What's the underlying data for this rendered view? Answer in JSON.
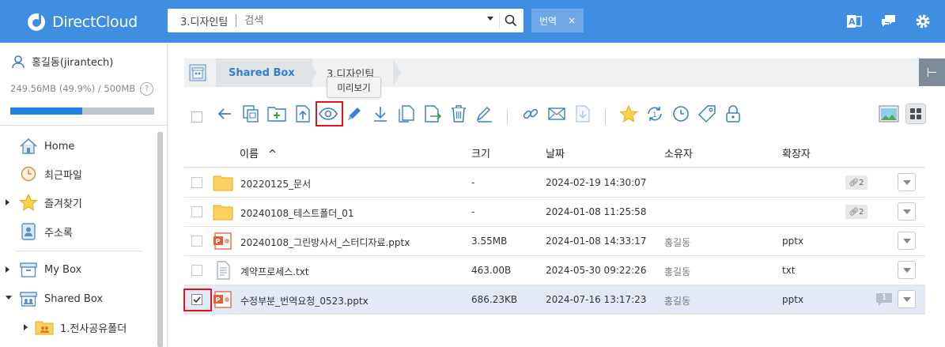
{
  "app": {
    "logo_text": "DirectCloud"
  },
  "search": {
    "folder": "3.디자인팀",
    "placeholder": "검색"
  },
  "tag_chip": {
    "label": "번역",
    "close": "×"
  },
  "header_icons": [
    "translate-icon",
    "chat-icon",
    "settings-gear-icon"
  ],
  "user": {
    "name": "홍길동(jirantech)"
  },
  "quota": {
    "text": "249.56MB (49.9%) / 500MB",
    "help": "?",
    "percent": 49.9
  },
  "sidebar": {
    "items": [
      {
        "label": "Home",
        "icon": "home-icon"
      },
      {
        "label": "최근파일",
        "icon": "recent-clock-icon"
      },
      {
        "label": "즐겨찾기",
        "icon": "star-icon"
      },
      {
        "label": "주소록",
        "icon": "address-book-icon"
      },
      {
        "label": "My Box",
        "icon": "my-box-icon"
      },
      {
        "label": "Shared Box",
        "icon": "shared-box-icon"
      },
      {
        "label": "1.전사공유폴더",
        "icon": "shared-folder-icon"
      }
    ]
  },
  "breadcrumb": {
    "items": [
      "Shared Box",
      "3.디자인팀"
    ]
  },
  "tooltip": {
    "text": "미리보기"
  },
  "toggle": {
    "label": "⊢"
  },
  "table": {
    "columns": [
      "이름",
      "크기",
      "날짜",
      "소유자",
      "확장자"
    ],
    "sort_indicator": "^",
    "rows": [
      {
        "name": "20220125_문서",
        "size": "-",
        "date": "2024-02-19 14:30:07",
        "owner": "",
        "ext": "",
        "type": "folder",
        "links": "2"
      },
      {
        "name": "20240108_테스트폴더_01",
        "size": "-",
        "date": "2024-01-08 11:25:58",
        "owner": "",
        "ext": "",
        "type": "folder",
        "links": "2"
      },
      {
        "name": "20240108_그린방사서_스터디자료.pptx",
        "size": "3.55MB",
        "date": "2024-01-08 14:33:17",
        "owner": "홍길동",
        "ext": "pptx",
        "type": "pptx"
      },
      {
        "name": "계약프로세스.txt",
        "size": "463.00B",
        "date": "2024-05-30 09:22:26",
        "owner": "홍길동",
        "ext": "txt",
        "type": "txt"
      },
      {
        "name": "수정부분_번역요청_0523.pptx",
        "size": "686.23KB",
        "date": "2024-07-16 13:17:23",
        "owner": "홍길동",
        "ext": "pptx",
        "type": "pptx",
        "comments": "1",
        "selected": true
      }
    ]
  },
  "colors": {
    "header": "#3f8ee2",
    "accent": "#2f7fd1",
    "highlight": "#e0141c",
    "selected_row": "#e3eaf6"
  }
}
